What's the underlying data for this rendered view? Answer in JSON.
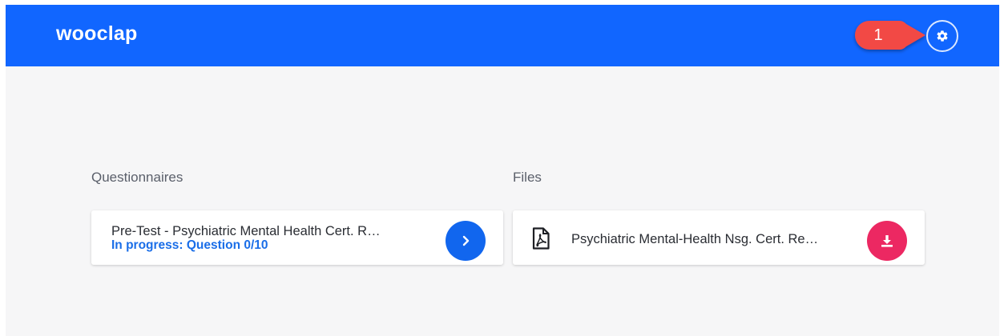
{
  "app": {
    "logo_text": "wooclap"
  },
  "header": {
    "settings_icon": "gear-icon",
    "callout_number": "1",
    "callout_color": "#f24a44",
    "bar_color": "#1166ff"
  },
  "questionnaires": {
    "section_label": "Questionnaires",
    "items": [
      {
        "title": "Pre-Test - Psychiatric Mental Health Cert. R…",
        "status": "In progress: Question 0/10",
        "action_icon": "chevron-right-icon",
        "action_color": "#1166ee"
      }
    ]
  },
  "files": {
    "section_label": "Files",
    "items": [
      {
        "file_icon": "pdf-file-icon",
        "title": "Psychiatric Mental-Health Nsg. Cert. Re…",
        "action_icon": "download-icon",
        "action_color": "#ec2862"
      }
    ]
  }
}
